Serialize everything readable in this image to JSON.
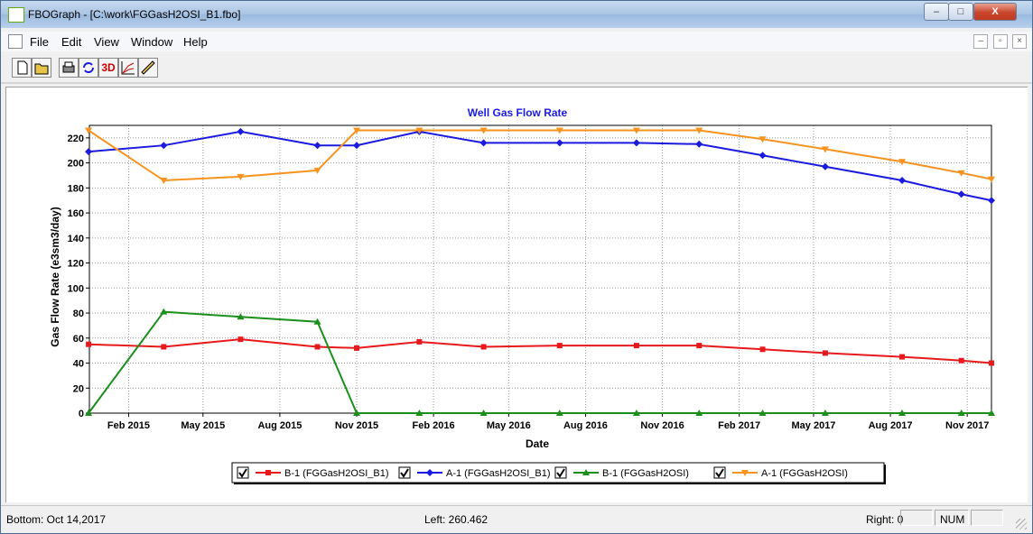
{
  "window": {
    "title": "FBOGraph - [C:\\work\\FGGasH2OSI_B1.fbo]",
    "buttons": {
      "minimize": "–",
      "maximize": "□",
      "close": "X"
    }
  },
  "menu": [
    "File",
    "Edit",
    "View",
    "Window",
    "Help"
  ],
  "mdi_buttons": [
    "–",
    "▫",
    "×"
  ],
  "toolbar": {
    "threed_label": "3D"
  },
  "status": {
    "bottom": "Bottom: Oct 14,2017",
    "left": "Left: 260.462",
    "right": "Right: 0",
    "num": "NUM"
  },
  "chart_data": {
    "type": "line",
    "title": "Well Gas Flow Rate",
    "xlabel": "Date",
    "ylabel": "Gas Flow Rate (e3sm3/day)",
    "ylim": [
      0,
      230
    ],
    "yticks": [
      0,
      20,
      40,
      60,
      80,
      100,
      120,
      140,
      160,
      180,
      200,
      220
    ],
    "xlim": [
      "2014-12-16",
      "2017-11-30"
    ],
    "xticks": [
      {
        "label": "Feb 2015",
        "date": "2015-02-01"
      },
      {
        "label": "May 2015",
        "date": "2015-05-01"
      },
      {
        "label": "Aug 2015",
        "date": "2015-08-01"
      },
      {
        "label": "Nov 2015",
        "date": "2015-11-01"
      },
      {
        "label": "Feb 2016",
        "date": "2016-02-01"
      },
      {
        "label": "May 2016",
        "date": "2016-05-01"
      },
      {
        "label": "Aug 2016",
        "date": "2016-08-01"
      },
      {
        "label": "Nov 2016",
        "date": "2016-11-01"
      },
      {
        "label": "Feb 2017",
        "date": "2017-02-01"
      },
      {
        "label": "May 2017",
        "date": "2017-05-01"
      },
      {
        "label": "Aug 2017",
        "date": "2017-08-01"
      },
      {
        "label": "Nov 2017",
        "date": "2017-11-01"
      }
    ],
    "grid": true,
    "legend_position": "bottom",
    "x": [
      "2014-12-15",
      "2015-03-15",
      "2015-06-15",
      "2015-09-15",
      "2015-12-15",
      "2016-03-15",
      "2016-06-15",
      "2016-09-15",
      "2016-12-15",
      "2017-03-15",
      "2017-06-15",
      "2017-09-15",
      "2017-11-30"
    ],
    "series": [
      {
        "name": "B-1 (FGGasH2OSI_B1)",
        "color": "#e8191c",
        "marker": "square",
        "points": [
          [
            "2014-12-15",
            55
          ],
          [
            "2015-03-15",
            53
          ],
          [
            "2015-06-15",
            59
          ],
          [
            "2015-09-15",
            53
          ],
          [
            "2015-11-01",
            52
          ],
          [
            "2016-01-15",
            57
          ],
          [
            "2016-04-01",
            53
          ],
          [
            "2016-07-01",
            54
          ],
          [
            "2016-10-01",
            54
          ],
          [
            "2016-12-15",
            54
          ],
          [
            "2017-03-01",
            51
          ],
          [
            "2017-05-15",
            48
          ],
          [
            "2017-08-15",
            45
          ],
          [
            "2017-10-25",
            42
          ],
          [
            "2017-11-30",
            40
          ]
        ]
      },
      {
        "name": "A-1 (FGGasH2OSI_B1)",
        "color": "#1b1bdf",
        "marker": "diamond",
        "points": [
          [
            "2014-12-15",
            209
          ],
          [
            "2015-03-15",
            214
          ],
          [
            "2015-06-15",
            225
          ],
          [
            "2015-09-15",
            214
          ],
          [
            "2015-11-01",
            214
          ],
          [
            "2016-01-15",
            225
          ],
          [
            "2016-04-01",
            216
          ],
          [
            "2016-07-01",
            216
          ],
          [
            "2016-10-01",
            216
          ],
          [
            "2016-12-15",
            215
          ],
          [
            "2017-03-01",
            206
          ],
          [
            "2017-05-15",
            197
          ],
          [
            "2017-08-15",
            186
          ],
          [
            "2017-10-25",
            175
          ],
          [
            "2017-11-30",
            170
          ]
        ]
      },
      {
        "name": "B-1 (FGGasH2OSI)",
        "color": "#1b8f1b",
        "marker": "triangle-up",
        "points": [
          [
            "2014-12-15",
            0
          ],
          [
            "2015-03-15",
            81
          ],
          [
            "2015-06-15",
            77
          ],
          [
            "2015-09-15",
            73
          ],
          [
            "2015-11-01",
            0
          ],
          [
            "2016-01-15",
            0
          ],
          [
            "2016-04-01",
            0
          ],
          [
            "2016-07-01",
            0
          ],
          [
            "2016-10-01",
            0
          ],
          [
            "2016-12-15",
            0
          ],
          [
            "2017-03-01",
            0
          ],
          [
            "2017-05-15",
            0
          ],
          [
            "2017-08-15",
            0
          ],
          [
            "2017-10-25",
            0
          ],
          [
            "2017-11-30",
            0
          ]
        ]
      },
      {
        "name": "A-1 (FGGasH2OSI)",
        "color": "#f7931e",
        "marker": "triangle-down",
        "points": [
          [
            "2014-12-15",
            226
          ],
          [
            "2015-03-15",
            186
          ],
          [
            "2015-06-15",
            189
          ],
          [
            "2015-09-15",
            194
          ],
          [
            "2015-11-01",
            226
          ],
          [
            "2016-01-15",
            226
          ],
          [
            "2016-04-01",
            226
          ],
          [
            "2016-07-01",
            226
          ],
          [
            "2016-10-01",
            226
          ],
          [
            "2016-12-15",
            226
          ],
          [
            "2017-03-01",
            219
          ],
          [
            "2017-05-15",
            211
          ],
          [
            "2017-08-15",
            201
          ],
          [
            "2017-10-25",
            192
          ],
          [
            "2017-11-30",
            187
          ]
        ]
      }
    ]
  }
}
